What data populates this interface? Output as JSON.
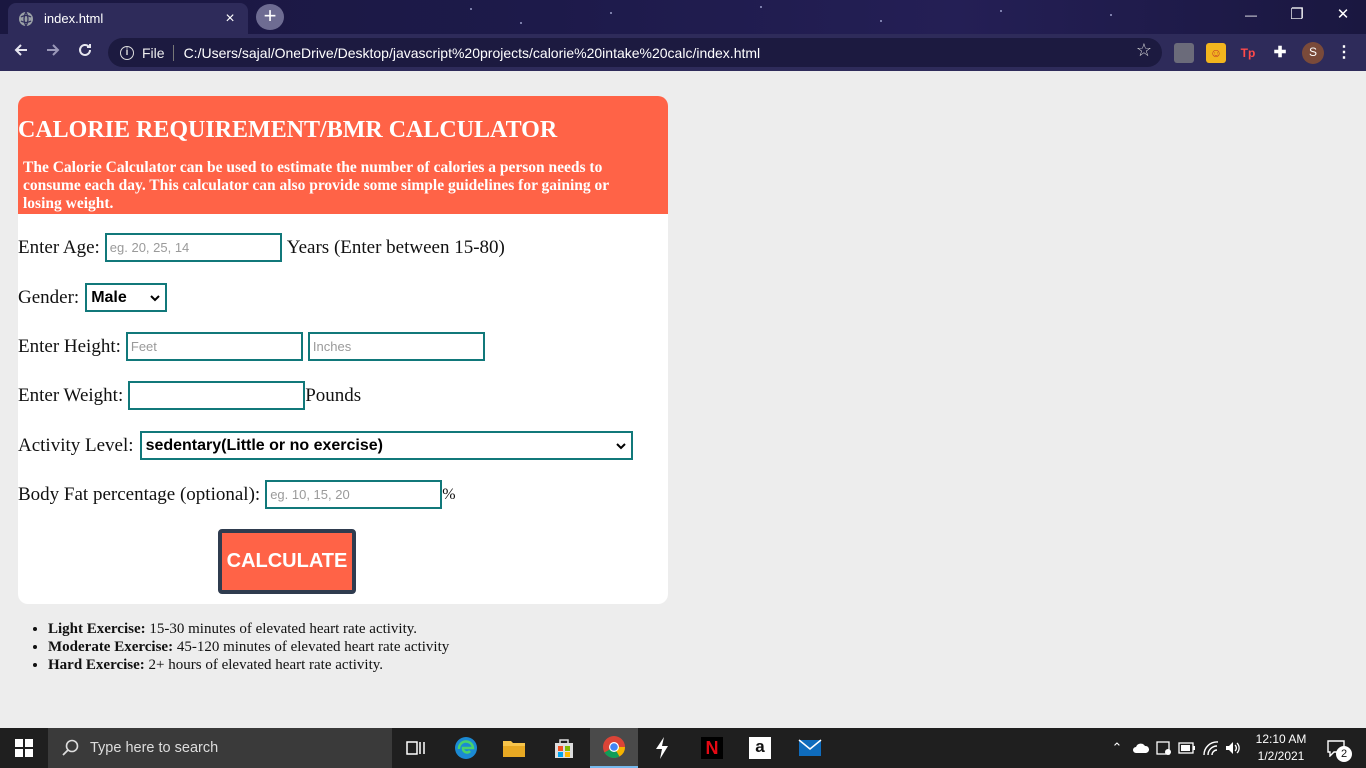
{
  "browser": {
    "tab_title": "index.html",
    "tab_close": "×",
    "new_tab": "+",
    "omnibox_scheme": "File",
    "url": "C:/Users/sajal/OneDrive/Desktop/javascript%20projects/calorie%20intake%20calc/index.html",
    "profile_initial": "S",
    "info_glyph": "i",
    "ext_acrobat": "",
    "ext_tp": "Tp",
    "win_minimize": "—",
    "win_restore": "❐",
    "win_close": "✕"
  },
  "page": {
    "title": "CALORIE REQUIREMENT/BMR CALCULATOR",
    "description": "The Calorie Calculator can be used to estimate the number of calories a person needs to consume each day. This calculator can also provide some simple guidelines for gaining or losing weight.",
    "age": {
      "label": "Enter Age:",
      "placeholder": "eg. 20, 25, 14",
      "suffix": "Years (Enter between 15-80)"
    },
    "gender": {
      "label": "Gender:",
      "selected": "Male"
    },
    "height": {
      "label": "Enter Height:",
      "feet_placeholder": "Feet",
      "inches_placeholder": "Inches"
    },
    "weight": {
      "label": "Enter Weight:",
      "value": "",
      "suffix": "Pounds"
    },
    "activity": {
      "label": "Activity Level:",
      "selected": "sedentary(Little or no exercise)"
    },
    "bodyfat": {
      "label": "Body Fat percentage (optional):",
      "placeholder": "eg. 10, 15, 20",
      "suffix": "%"
    },
    "calculate_label": "CALCULATE",
    "notes": [
      {
        "term": "Light Exercise:",
        "text": " 15-30 minutes of elevated heart rate activity."
      },
      {
        "term": "Moderate Exercise:",
        "text": " 45-120 minutes of elevated heart rate activity"
      },
      {
        "term": "Hard Exercise:",
        "text": " 2+ hours of elevated heart rate activity."
      }
    ]
  },
  "taskbar": {
    "search_placeholder": "Type here to search",
    "time": "12:10 AM",
    "date": "1/2/2021",
    "notification_count": "2",
    "amazon_glyph": "a",
    "netflix_glyph": "N"
  },
  "colors": {
    "header": "#ff6347",
    "field_border": "#11787a",
    "button_border": "#2f3c4f",
    "page_bg": "#ededed",
    "chrome_bg": "#2e2b5a"
  }
}
